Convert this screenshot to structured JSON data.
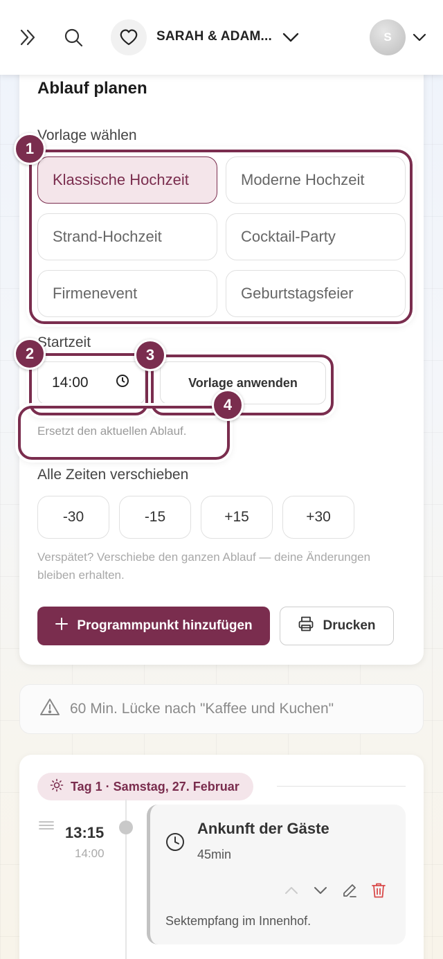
{
  "header": {
    "event_name": "SARAH & ADAM...",
    "avatar_initial": "S"
  },
  "planner": {
    "title": "Ablauf planen",
    "template_label": "Vorlage wählen",
    "templates": [
      {
        "label": "Klassische Hochzeit",
        "selected": true
      },
      {
        "label": "Moderne Hochzeit",
        "selected": false
      },
      {
        "label": "Strand-Hochzeit",
        "selected": false
      },
      {
        "label": "Cocktail-Party",
        "selected": false
      },
      {
        "label": "Firmenevent",
        "selected": false
      },
      {
        "label": "Geburtstagsfeier",
        "selected": false
      }
    ],
    "start_label": "Startzeit",
    "start_time": "14:00",
    "apply_label": "Vorlage anwenden",
    "apply_hint": "Ersetzt den aktuellen Ablauf.",
    "shift_label": "Alle Zeiten verschieben",
    "shift_buttons": [
      "-30",
      "-15",
      "+15",
      "+30"
    ],
    "shift_note": "Verspätet? Verschiebe den ganzen Ablauf — deine Änderungen bleiben erhalten.",
    "add_label": "Programmpunkt hinzufügen",
    "print_label": "Drucken"
  },
  "callouts": [
    "1",
    "2",
    "3",
    "4"
  ],
  "warning": {
    "text": "60 Min. Lücke nach \"Kaffee und Kuchen\""
  },
  "day": {
    "label": "Tag 1 · Samstag, 27. Februar",
    "items": [
      {
        "time": "13:15",
        "end_time": "14:00",
        "title": "Ankunft der Gäste",
        "duration": "45min",
        "note": "Sektempfang im Innenhof."
      }
    ]
  },
  "colors": {
    "accent": "#7a2d4e",
    "accent_light": "#f4e5ea",
    "delete": "#d94a4a"
  }
}
